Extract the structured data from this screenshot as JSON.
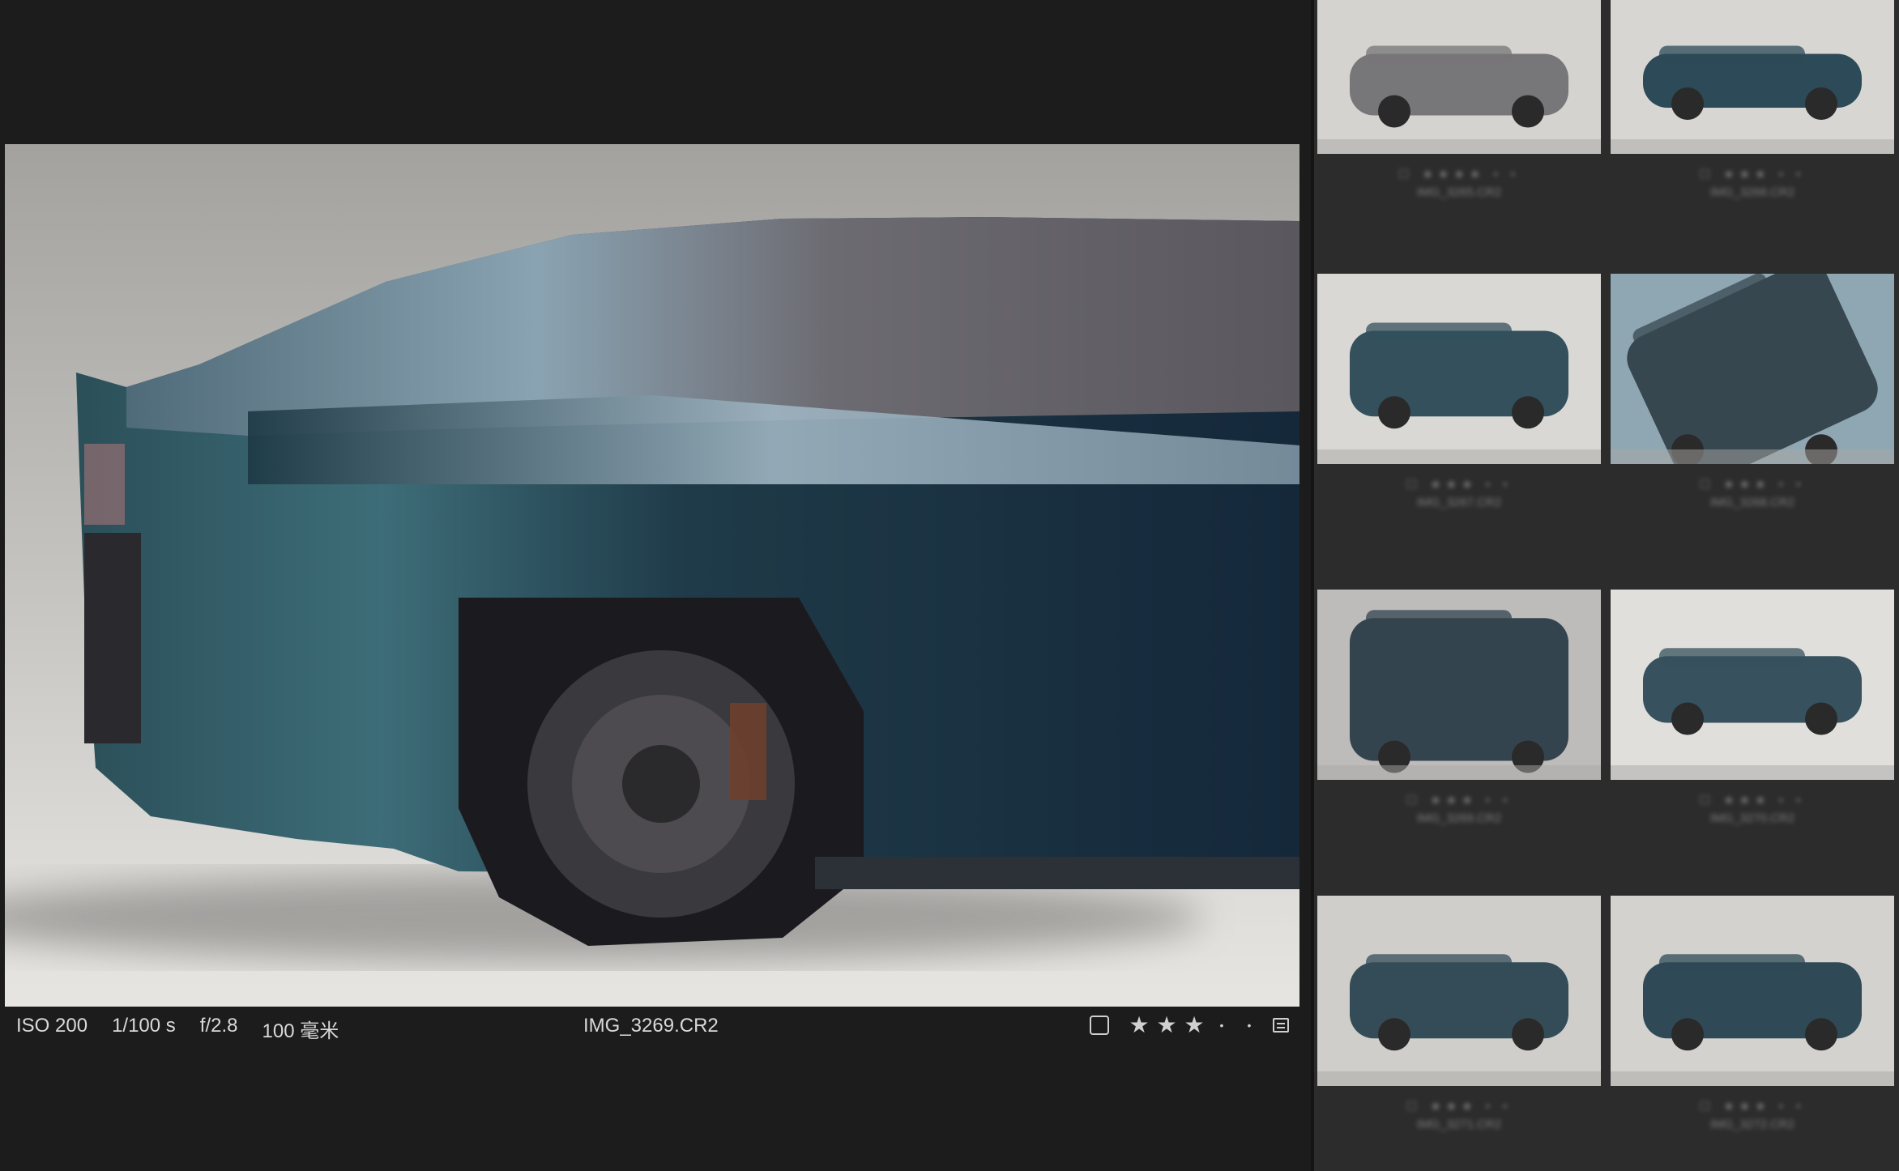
{
  "viewer": {
    "exif": {
      "iso": "ISO 200",
      "shutter": "1/100 s",
      "aperture": "f/2.8",
      "focal": "100 毫米"
    },
    "filename": "IMG_3269.CR2",
    "rating": {
      "stars_filled": 3,
      "stars_total": 5,
      "star_glyph": "★",
      "empty_glyph": "•"
    }
  },
  "filmstrip": {
    "thumbnails": [
      {
        "meta_line1": "☐ ★★★★ • •",
        "meta_line2": "IMG_3265.CR2"
      },
      {
        "meta_line1": "☐ ★★★ • •",
        "meta_line2": "IMG_3266.CR2"
      },
      {
        "meta_line1": "☐ ★★★ • •",
        "meta_line2": "IMG_3267.CR2"
      },
      {
        "meta_line1": "☐ ★★★ • •",
        "meta_line2": "IMG_3268.CR2"
      },
      {
        "meta_line1": "☐ ★★★ • •",
        "meta_line2": "IMG_3269.CR2"
      },
      {
        "meta_line1": "☐ ★★★ • •",
        "meta_line2": "IMG_3270.CR2"
      },
      {
        "meta_line1": "☐ ★★★ • •",
        "meta_line2": "IMG_3271.CR2"
      },
      {
        "meta_line1": "☐ ★★★ • •",
        "meta_line2": "IMG_3272.CR2"
      }
    ]
  },
  "colors": {
    "background": "#1c1c1c",
    "filmstrip_bg": "#2c2c2c",
    "text": "#d9d9d9",
    "car_teal": "#2e5563"
  }
}
